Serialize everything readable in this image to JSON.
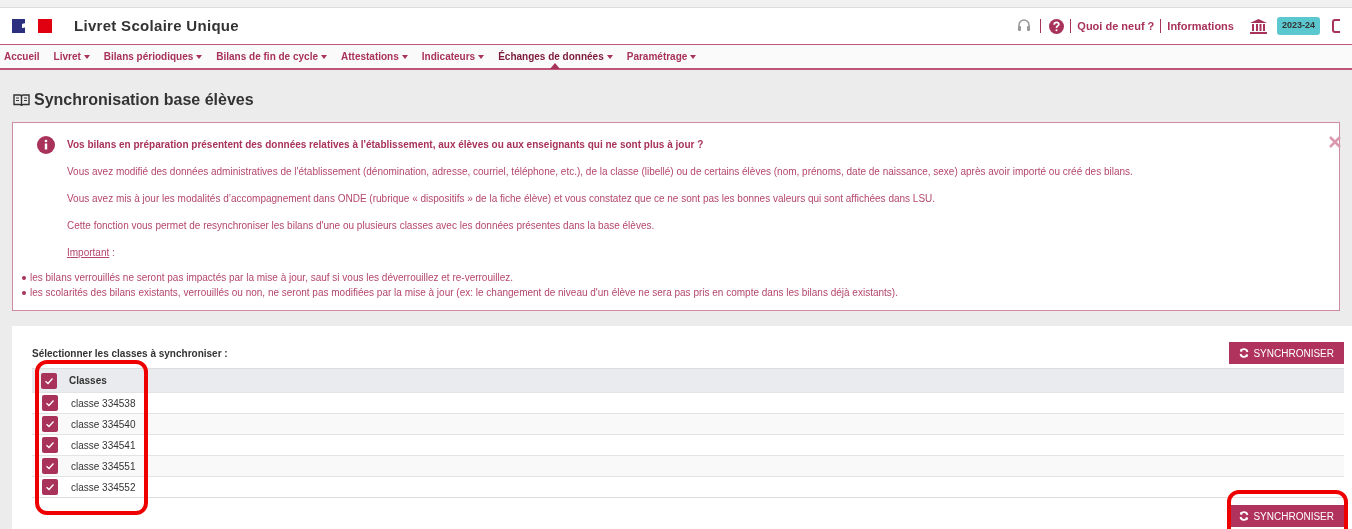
{
  "header": {
    "app_title": "Livret Scolaire Unique",
    "links": [
      "Quoi de neuf ?",
      "Informations"
    ],
    "year_badge": "2023-24"
  },
  "nav": [
    {
      "label": "Accueil",
      "dropdown": false,
      "selected": false
    },
    {
      "label": "Livret",
      "dropdown": true,
      "selected": false
    },
    {
      "label": "Bilans périodiques",
      "dropdown": true,
      "selected": false
    },
    {
      "label": "Bilans de fin de cycle",
      "dropdown": true,
      "selected": false
    },
    {
      "label": "Attestations",
      "dropdown": true,
      "selected": false
    },
    {
      "label": "Indicateurs",
      "dropdown": true,
      "selected": false
    },
    {
      "label": "Échanges de données",
      "dropdown": true,
      "selected": true
    },
    {
      "label": "Paramétrage",
      "dropdown": true,
      "selected": false
    }
  ],
  "page_title": "Synchronisation base élèves",
  "alert": {
    "heading": "Vos bilans en préparation présentent des données relatives à l'établissement, aux élèves ou aux enseignants qui ne sont plus à jour ?",
    "paragraphs": [
      "Vous avez modifié des données administratives de l'établissement (dénomination, adresse, courriel, téléphone, etc.), de la classe (libellé) ou de certains élèves (nom, prénoms, date de naissance, sexe) après avoir importé ou créé des bilans.",
      "Vous avez mis à jour les modalités d’accompagnement dans ONDE (rubrique « dispositifs » de la fiche élève) et vous constatez que ce ne sont pas les bonnes valeurs qui sont affichées dans LSU.",
      "Cette fonction vous permet de resynchroniser les bilans d'une ou plusieurs classes avec les données présentes dans la base élèves."
    ],
    "important_label": "Important",
    "important_suffix": " :",
    "bullets": [
      "les bilans verrouillés ne seront pas impactés par la mise à jour, sauf si vous les déverrouillez et re-verrouillez.",
      "les scolarités des bilans existants, verrouillés ou non, ne seront pas modifiées par la mise à jour (ex: le changement de niveau d'un élève ne sera pas pris en compte dans les bilans déjà existants)."
    ]
  },
  "selection": {
    "label": "Sélectionner les classes à synchroniser :",
    "button": "SYNCHRONISER",
    "bottom_button": "SYNCHRONISER",
    "table": {
      "header": {
        "label": "Classes",
        "checked": true
      },
      "rows": [
        {
          "label": "classe 334538",
          "checked": true
        },
        {
          "label": "classe 334540",
          "checked": true
        },
        {
          "label": "classe 334541",
          "checked": true
        },
        {
          "label": "classe 334551",
          "checked": true
        },
        {
          "label": "classe 334552",
          "checked": true
        }
      ]
    }
  }
}
